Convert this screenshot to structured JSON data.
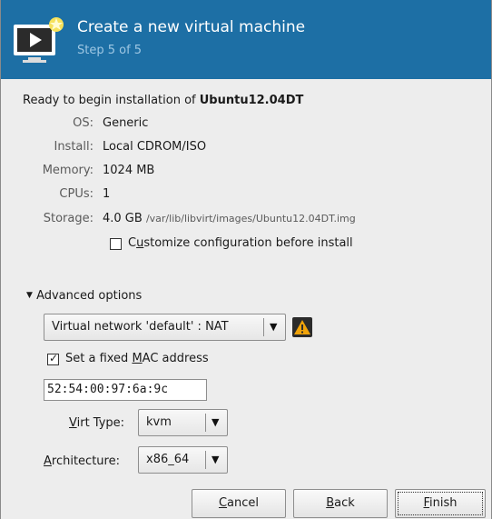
{
  "header": {
    "title": "Create a new virtual machine",
    "step": "Step 5 of 5"
  },
  "summary": {
    "ready_prefix": "Ready to begin installation of ",
    "vm_name": "Ubuntu12.04DT",
    "rows": [
      {
        "label": "OS:",
        "value": "Generic"
      },
      {
        "label": "Install:",
        "value": "Local CDROM/ISO"
      },
      {
        "label": "Memory:",
        "value": "1024 MB"
      },
      {
        "label": "CPUs:",
        "value": "1"
      },
      {
        "label": "Storage:",
        "value": "4.0 GB",
        "path": "/var/lib/libvirt/images/Ubuntu12.04DT.img"
      }
    ],
    "customize_label_pre": "C",
    "customize_label_mn": "u",
    "customize_label_post": "stomize configuration before install",
    "customize_checked": false
  },
  "advanced": {
    "expander_label": "Advanced options",
    "network_value": "Virtual network 'default' : NAT",
    "mac_checkbox_pre": "Set a fixed ",
    "mac_checkbox_mn": "M",
    "mac_checkbox_post": "AC address",
    "mac_checked": true,
    "mac_value": "52:54:00:97:6a:9c",
    "virt_type_label_mn": "V",
    "virt_type_label_post": "irt Type:",
    "virt_type_value": "kvm",
    "arch_label_mn": "A",
    "arch_label_post": "rchitecture:",
    "arch_value": "x86_64"
  },
  "buttons": {
    "cancel_mn": "C",
    "cancel_post": "ancel",
    "back_mn": "B",
    "back_post": "ack",
    "finish_mn": "F",
    "finish_post": "inish"
  },
  "colors": {
    "header_bg": "#1d6fa5",
    "step_text": "#9ec7e3",
    "warning": "#f0a30a"
  }
}
